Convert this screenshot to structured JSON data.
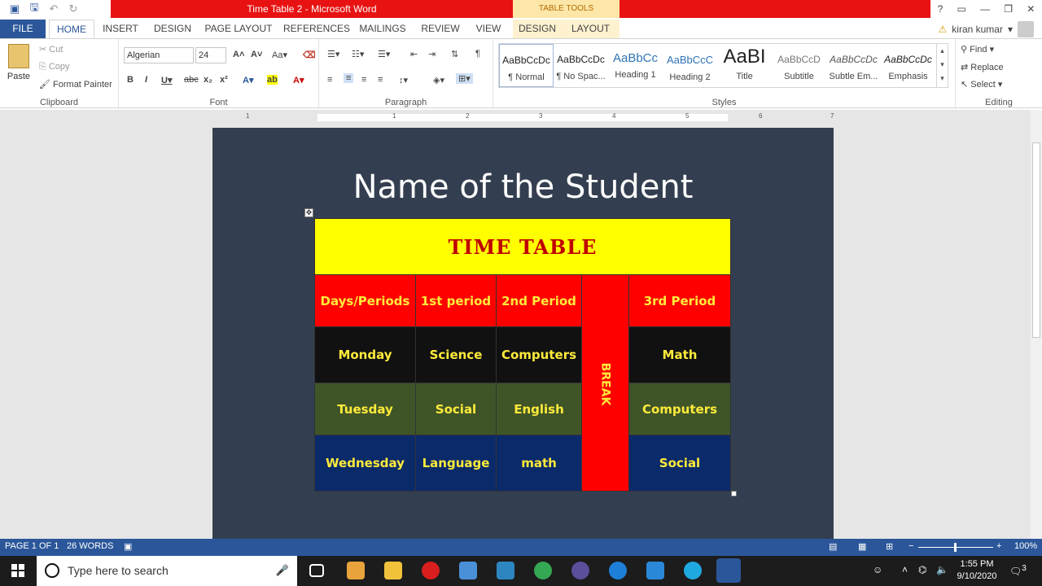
{
  "titlebar": {
    "title": "Time Table 2 -  Microsoft Word",
    "context_tab": "TABLE TOOLS",
    "help": "?"
  },
  "tabs": {
    "file": "FILE",
    "home": "HOME",
    "insert": "INSERT",
    "design": "DESIGN",
    "page_layout": "PAGE LAYOUT",
    "references": "REFERENCES",
    "mailings": "MAILINGS",
    "review": "REVIEW",
    "view": "VIEW",
    "tt_design": "DESIGN",
    "tt_layout": "LAYOUT"
  },
  "user": {
    "name": "kiran kumar"
  },
  "clipboard": {
    "paste": "Paste",
    "cut": "Cut",
    "copy": "Copy",
    "format_painter": "Format Painter",
    "label": "Clipboard"
  },
  "font": {
    "family": "Algerian",
    "size": "24",
    "label": "Font"
  },
  "paragraph": {
    "label": "Paragraph"
  },
  "styles": {
    "label": "Styles",
    "items": [
      {
        "preview": "AaBbCcDc",
        "name": "¶ Normal"
      },
      {
        "preview": "AaBbCcDc",
        "name": "¶ No Spac..."
      },
      {
        "preview": "AaBbCc",
        "name": "Heading 1"
      },
      {
        "preview": "AaBbCcC",
        "name": "Heading 2"
      },
      {
        "preview": "AaBI",
        "name": "Title"
      },
      {
        "preview": "AaBbCcD",
        "name": "Subtitle"
      },
      {
        "preview": "AaBbCcDc",
        "name": "Subtle Em..."
      },
      {
        "preview": "AaBbCcDc",
        "name": "Emphasis"
      }
    ]
  },
  "editing": {
    "find": "Find",
    "replace": "Replace",
    "select": "Select",
    "label": "Editing"
  },
  "document": {
    "title": "Name of the Student",
    "table_title": "TIME TABLE",
    "headers": [
      "Days/Periods",
      "1st period",
      "2nd Period",
      "3rd Period"
    ],
    "break_label": "BREAK",
    "rows": [
      {
        "day": "Monday",
        "p1": "Science",
        "p2": "Computers",
        "p3": "Math"
      },
      {
        "day": "Tuesday",
        "p1": "Social",
        "p2": "English",
        "p3": "Computers"
      },
      {
        "day": "Wednesday",
        "p1": "Language",
        "p2": "math",
        "p3": "Social"
      }
    ]
  },
  "status": {
    "page": "PAGE 1 OF 1",
    "words": "26 WORDS",
    "zoom": "100%"
  },
  "taskbar": {
    "search_placeholder": "Type here to search",
    "time": "1:55 PM",
    "date": "9/10/2020",
    "notifications": "3"
  }
}
